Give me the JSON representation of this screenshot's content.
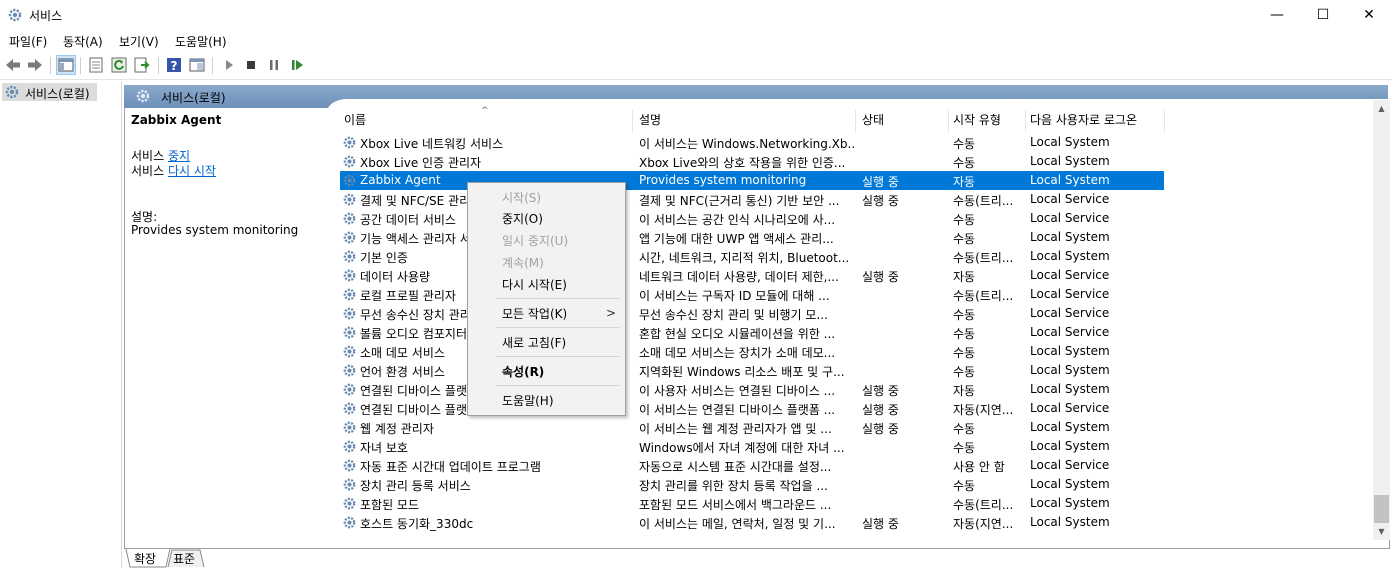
{
  "window": {
    "title": "서비스",
    "min": "—",
    "max": "☐",
    "close": "✕"
  },
  "menu": [
    "파일(F)",
    "동작(A)",
    "보기(V)",
    "도움말(H)"
  ],
  "toolbar_icons": [
    "back-icon",
    "forward-icon",
    "console-tree-icon",
    "properties-icon",
    "refresh-icon",
    "export-icon",
    "help-icon",
    "view-icon",
    "start-icon",
    "stop-icon",
    "pause-icon",
    "restart-icon"
  ],
  "tree": {
    "label": "서비스(로컬)"
  },
  "main_header": {
    "title": "서비스(로컬)"
  },
  "details": {
    "name": "Zabbix Agent",
    "stop_prefix": "서비스 ",
    "stop_link": "중지",
    "restart_prefix": "서비스 ",
    "restart_link": "다시 시작",
    "desc_label": "설명:",
    "desc_text": "Provides system monitoring"
  },
  "columns": {
    "name": "이름",
    "desc": "설명",
    "status": "상태",
    "start": "시작 유형",
    "logon": "다음 사용자로 로그온"
  },
  "sort_indicator": "^",
  "services": [
    {
      "name": "Xbox Live 네트워킹 서비스",
      "desc": "이 서비스는 Windows.Networking.Xb...",
      "status": "",
      "start": "수동",
      "logon": "Local System"
    },
    {
      "name": "Xbox Live 인증 관리자",
      "desc": "Xbox Live와의 상호 작용을 위한 인증...",
      "status": "",
      "start": "수동",
      "logon": "Local System"
    },
    {
      "name": "Zabbix Agent",
      "desc": "Provides system monitoring",
      "status": "실행 중",
      "start": "자동",
      "logon": "Local System",
      "selected": true
    },
    {
      "name": "결제 및 NFC/SE 관리자",
      "desc": "결제 및 NFC(근거리 통신) 기반 보안 ...",
      "status": "실행 중",
      "start": "수동(트리...",
      "logon": "Local Service"
    },
    {
      "name": "공간 데이터 서비스",
      "desc": "이 서비스는 공간 인식 시나리오에 사...",
      "status": "",
      "start": "수동",
      "logon": "Local Service"
    },
    {
      "name": "기능 액세스 관리자 서비스",
      "desc": "앱 기능에 대한 UWP 앱 액세스 관리...",
      "status": "",
      "start": "수동",
      "logon": "Local System"
    },
    {
      "name": "기본 인증",
      "desc": "시간, 네트워크, 지리적 위치, Bluetoot...",
      "status": "",
      "start": "수동(트리...",
      "logon": "Local System"
    },
    {
      "name": "데이터 사용량",
      "desc": "네트워크 데이터 사용량, 데이터 제한,...",
      "status": "실행 중",
      "start": "자동",
      "logon": "Local Service"
    },
    {
      "name": "로컬 프로필 관리자",
      "desc": "이 서비스는 구독자 ID 모듈에 대해 ...",
      "status": "",
      "start": "수동(트리...",
      "logon": "Local Service"
    },
    {
      "name": "무선 송수신 장치 관리 서비스",
      "desc": "무선 송수신 장치 관리 및 비행기 모...",
      "status": "",
      "start": "수동",
      "logon": "Local Service"
    },
    {
      "name": "볼륨 오디오 컴포지터",
      "desc": "혼합 현실 오디오 시뮬레이션을 위한 ...",
      "status": "",
      "start": "수동",
      "logon": "Local Service"
    },
    {
      "name": "소매 데모 서비스",
      "desc": "소매 데모 서비스는 장치가 소매 데모...",
      "status": "",
      "start": "수동",
      "logon": "Local System"
    },
    {
      "name": "언어 환경 서비스",
      "desc": "지역화된 Windows 리소스 배포 및 구...",
      "status": "",
      "start": "수동",
      "logon": "Local System"
    },
    {
      "name": "연결된 디바이스 플랫폼",
      "desc": "이 사용자 서비스는 연결된 디바이스 ...",
      "status": "실행 중",
      "start": "자동",
      "logon": "Local System"
    },
    {
      "name": "연결된 디바이스 플랫폼",
      "desc": "이 서비스는 연결된 디바이스 플랫폼 ...",
      "status": "실행 중",
      "start": "자동(지연...",
      "logon": "Local Service"
    },
    {
      "name": "웹 계정 관리자",
      "desc": "이 서비스는 웹 계정 관리자가 앱 및 ...",
      "status": "실행 중",
      "start": "수동",
      "logon": "Local System"
    },
    {
      "name": "자녀 보호",
      "desc": "Windows에서 자녀 계정에 대한 자녀 ...",
      "status": "",
      "start": "수동",
      "logon": "Local System"
    },
    {
      "name": "자동 표준 시간대 업데이트 프로그램",
      "desc": "자동으로 시스템 표준 시간대를 설정...",
      "status": "",
      "start": "사용 안 함",
      "logon": "Local Service"
    },
    {
      "name": "장치 관리 등록 서비스",
      "desc": "장치 관리를 위한 장치 등록 작업을 ...",
      "status": "",
      "start": "수동",
      "logon": "Local System"
    },
    {
      "name": "포함된 모드",
      "desc": "포함된 모드 서비스에서 백그라운드 ...",
      "status": "",
      "start": "수동(트리...",
      "logon": "Local System"
    },
    {
      "name": "호스트 동기화_330dc",
      "desc": "이 서비스는 메일, 연락처, 일정 및 기...",
      "status": "실행 중",
      "start": "자동(지연...",
      "logon": "Local System"
    }
  ],
  "context_menu": [
    {
      "label": "시작(S)",
      "disabled": true
    },
    {
      "label": "중지(O)"
    },
    {
      "label": "일시 중지(U)",
      "disabled": true
    },
    {
      "label": "계속(M)",
      "disabled": true
    },
    {
      "label": "다시 시작(E)"
    },
    {
      "label": "모든 작업(K)",
      "submenu": ">"
    },
    {
      "label": "새로 고침(F)"
    },
    {
      "label": "속성(R)",
      "bold": true
    },
    {
      "label": "도움말(H)"
    }
  ],
  "bottom_tabs": [
    "확장",
    "표준"
  ]
}
